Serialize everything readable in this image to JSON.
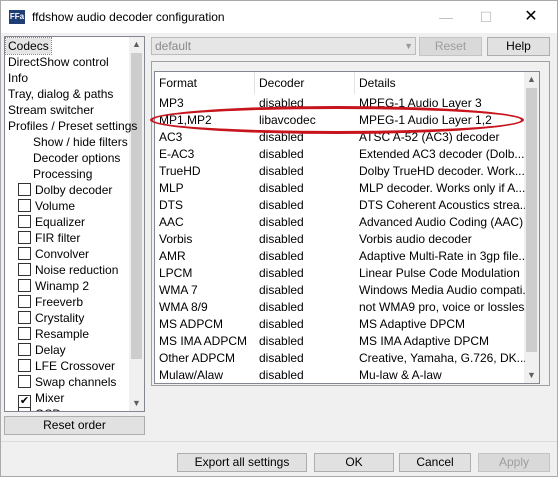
{
  "window": {
    "title": "ffdshow audio decoder configuration",
    "app_icon_text": "FFa",
    "min_glyph": "—",
    "max_glyph": "☐",
    "close_glyph": "✕"
  },
  "sidebar": {
    "items": [
      {
        "label": "Codecs",
        "type": "plain",
        "selected": true
      },
      {
        "label": "DirectShow control",
        "type": "plain"
      },
      {
        "label": "Info",
        "type": "plain"
      },
      {
        "label": "Tray, dialog & paths",
        "type": "plain"
      },
      {
        "label": "Stream switcher",
        "type": "plain"
      },
      {
        "label": "Profiles / Preset settings",
        "type": "plain"
      },
      {
        "label": "Show / hide filters",
        "type": "indent"
      },
      {
        "label": "Decoder options",
        "type": "indent"
      },
      {
        "label": "Processing",
        "type": "indent"
      },
      {
        "label": "Dolby decoder",
        "type": "check",
        "checked": false
      },
      {
        "label": "Volume",
        "type": "check",
        "checked": false
      },
      {
        "label": "Equalizer",
        "type": "check",
        "checked": false
      },
      {
        "label": "FIR filter",
        "type": "check",
        "checked": false
      },
      {
        "label": "Convolver",
        "type": "check",
        "checked": false
      },
      {
        "label": "Noise reduction",
        "type": "check",
        "checked": false
      },
      {
        "label": "Winamp 2",
        "type": "check",
        "checked": false
      },
      {
        "label": "Freeverb",
        "type": "check",
        "checked": false
      },
      {
        "label": "Crystality",
        "type": "check",
        "checked": false
      },
      {
        "label": "Resample",
        "type": "check",
        "checked": false
      },
      {
        "label": "Delay",
        "type": "check",
        "checked": false
      },
      {
        "label": "LFE Crossover",
        "type": "check",
        "checked": false
      },
      {
        "label": "Swap channels",
        "type": "check",
        "checked": false
      },
      {
        "label": "Mixer",
        "type": "check",
        "checked": true
      },
      {
        "label": "OSD",
        "type": "check",
        "checked": false
      }
    ],
    "reset_order_label": "Reset order"
  },
  "preset": {
    "value": "default",
    "reset_label": "Reset",
    "help_label": "Help"
  },
  "codec_table": {
    "columns": [
      "Format",
      "Decoder",
      "Details"
    ],
    "rows": [
      [
        "MP3",
        "disabled",
        "MPEG-1 Audio Layer 3"
      ],
      [
        "MP1,MP2",
        "libavcodec",
        "MPEG-1 Audio Layer 1,2"
      ],
      [
        "AC3",
        "disabled",
        "ATSC A-52 (AC3) decoder"
      ],
      [
        "E-AC3",
        "disabled",
        "Extended AC3 decoder (Dolb..."
      ],
      [
        "TrueHD",
        "disabled",
        "Dolby TrueHD decoder. Work..."
      ],
      [
        "MLP",
        "disabled",
        "MLP decoder. Works only if A..."
      ],
      [
        "DTS",
        "disabled",
        "DTS Coherent Acoustics strea..."
      ],
      [
        "AAC",
        "disabled",
        "Advanced Audio Coding (AAC)"
      ],
      [
        "Vorbis",
        "disabled",
        "Vorbis audio decoder"
      ],
      [
        "AMR",
        "disabled",
        "Adaptive Multi-Rate in 3gp file..."
      ],
      [
        "LPCM",
        "disabled",
        "Linear Pulse Code Modulation"
      ],
      [
        "WMA 7",
        "disabled",
        "Windows Media Audio compati..."
      ],
      [
        "WMA 8/9",
        "disabled",
        "not WMA9 pro, voice or lossless"
      ],
      [
        "MS ADPCM",
        "disabled",
        "MS Adaptive DPCM"
      ],
      [
        "MS IMA ADPCM",
        "disabled",
        "MS IMA Adaptive DPCM"
      ],
      [
        "Other ADPCM",
        "disabled",
        "Creative, Yamaha, G.726, DK..."
      ],
      [
        "Mulaw/Alaw",
        "disabled",
        "Mu-law & A-law"
      ]
    ],
    "highlighted_row": 1,
    "highlight_color": "#c8141d"
  },
  "footer": {
    "export_label": "Export all settings",
    "ok_label": "OK",
    "cancel_label": "Cancel",
    "apply_label": "Apply"
  }
}
